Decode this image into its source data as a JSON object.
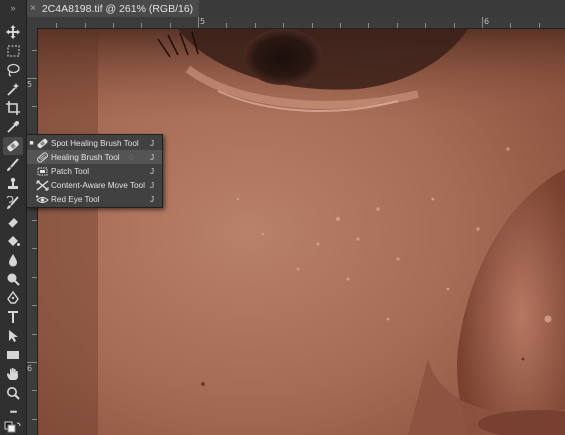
{
  "document": {
    "tab_close": "×",
    "title": "2C4A8198.tif @ 261% (RGB/16)"
  },
  "rulers": {
    "top_labels": [
      "5",
      "6"
    ],
    "left_labels": [
      "5",
      "6"
    ]
  },
  "toolbar": {
    "collapse_glyph": "»",
    "more_glyph": "•••"
  },
  "flyout": {
    "items": [
      {
        "label": "Spot Healing Brush Tool",
        "shortcut": "J",
        "current": true,
        "icon": "spot-healing-brush-icon"
      },
      {
        "label": "Healing Brush Tool",
        "shortcut": "J",
        "current": false,
        "icon": "healing-brush-icon"
      },
      {
        "label": "Patch Tool",
        "shortcut": "J",
        "current": false,
        "icon": "patch-icon"
      },
      {
        "label": "Content-Aware Move Tool",
        "shortcut": "J",
        "current": false,
        "icon": "content-aware-move-icon"
      },
      {
        "label": "Red Eye Tool",
        "shortcut": "J",
        "current": false,
        "icon": "red-eye-icon"
      }
    ],
    "current_marker": "■",
    "loading_glyph": "◌"
  },
  "colors": {
    "ui_dark": "#303030",
    "panel": "#414141",
    "highlight": "#545454",
    "skin": "#a86d55"
  }
}
